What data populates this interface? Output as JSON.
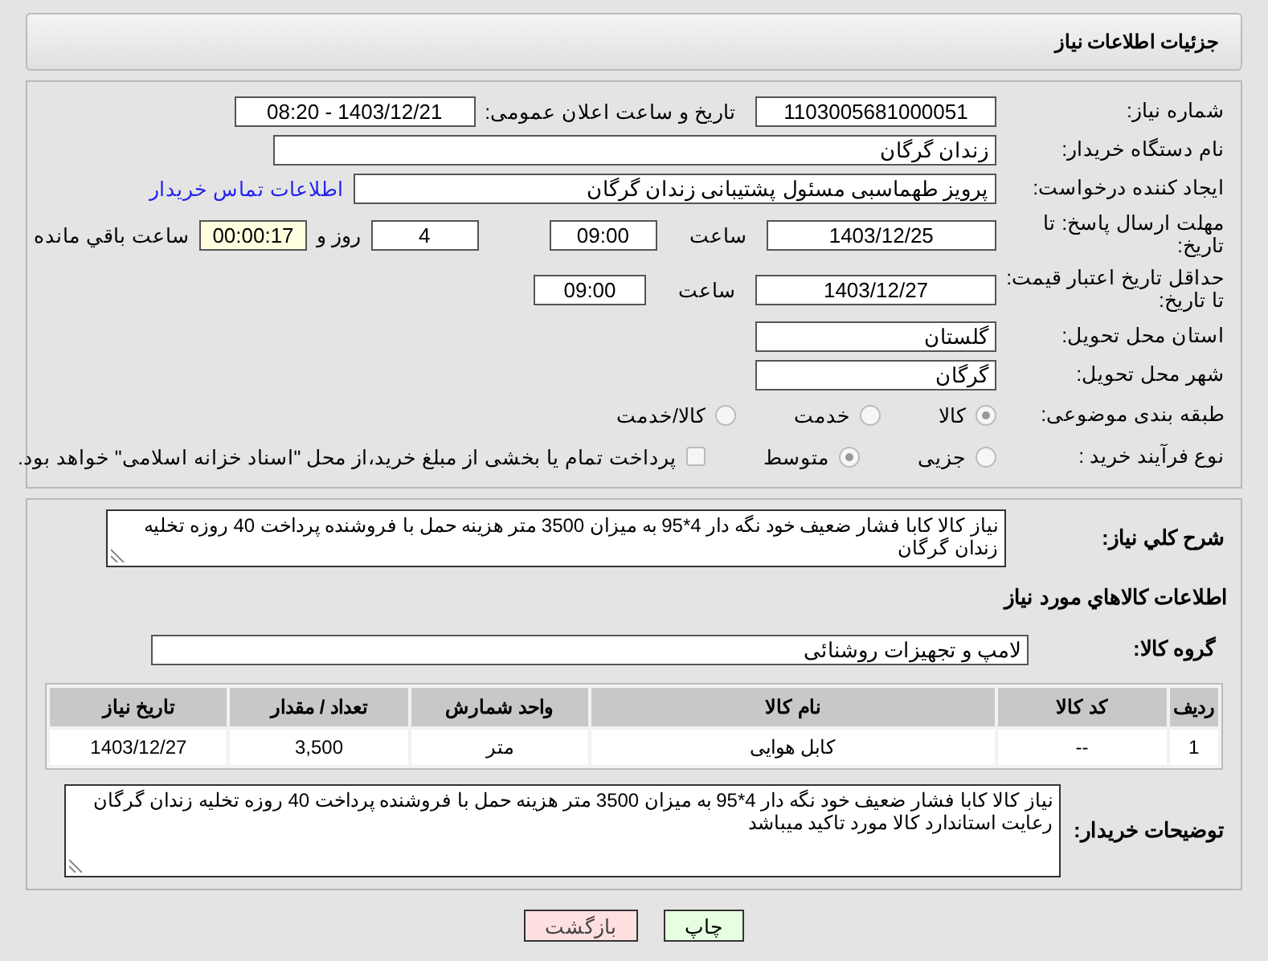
{
  "header": {
    "title": "جزئیات اطلاعات نیاز"
  },
  "form": {
    "need_number": {
      "label": "شماره نیاز:",
      "value": "1103005681000051"
    },
    "announce": {
      "label": "تاریخ و ساعت اعلان عمومی:",
      "value": "1403/12/21 - 08:20"
    },
    "buyer_org": {
      "label": "نام دستگاه خریدار:",
      "value": "زندان گرگان"
    },
    "creator": {
      "label": "ایجاد کننده درخواست:",
      "value": "پرویز طهماسبی مسئول پشتیبانی زندان گرگان",
      "link": "اطلاعات تماس خریدار"
    },
    "deadline": {
      "label": "مهلت ارسال پاسخ: تا تاریخ:",
      "date": "1403/12/25",
      "time_label": "ساعت",
      "time": "09:00",
      "days": "4",
      "days_label": "روز و",
      "remaining": "00:00:17",
      "remaining_label": "ساعت باقي مانده"
    },
    "validity": {
      "label": "حداقل تاریخ اعتبار قیمت: تا تاریخ:",
      "date": "1403/12/27",
      "time_label": "ساعت",
      "time": "09:00"
    },
    "province": {
      "label": "استان محل تحویل:",
      "value": "گلستان"
    },
    "city": {
      "label": "شهر محل تحویل:",
      "value": "گرگان"
    },
    "category": {
      "label": "طبقه بندی موضوعی:",
      "options": [
        {
          "label": "کالا",
          "selected": true
        },
        {
          "label": "خدمت",
          "selected": false
        },
        {
          "label": "کالا/خدمت",
          "selected": false
        }
      ]
    },
    "process": {
      "label": "نوع فرآیند خرید :",
      "options": [
        {
          "label": "جزیی",
          "selected": false
        },
        {
          "label": "متوسط",
          "selected": true
        }
      ],
      "treasury": {
        "label": "پرداخت تمام یا بخشی از مبلغ خرید،از محل \"اسناد خزانه اسلامی\" خواهد بود.",
        "checked": false
      }
    }
  },
  "details": {
    "summary": {
      "label": "شرح کلي نياز:",
      "value": "نیاز کالا کابا فشار ضعیف خود نگه دار  4*95 به میزان 3500 متر هزینه حمل با فروشنده پرداخت 40 روزه تخلیه زندان گرگان"
    },
    "items_title": "اطلاعات کالاهاي مورد نياز",
    "group": {
      "label": "گروه کالا:",
      "value": "لامپ و تجهیزات روشنائی"
    },
    "table": {
      "columns": [
        "ردیف",
        "کد کالا",
        "نام کالا",
        "واحد شمارش",
        "تعداد / مقدار",
        "تاریخ نیاز"
      ],
      "rows": [
        [
          "1",
          "--",
          "کابل هوایی",
          "متر",
          "3,500",
          "1403/12/27"
        ]
      ]
    },
    "notes": {
      "label": "توضیحات خریدار:",
      "value": "نیاز کالا کابا فشار ضعیف خود نگه دار  4*95 به میزان 3500 متر هزینه حمل با فروشنده پرداخت 40 روزه تخلیه زندان گرگان رعایت استاندارد کالا مورد تاکید میباشد"
    }
  },
  "buttons": [
    {
      "label": "چاپ",
      "kind": "print"
    },
    {
      "label": "بازگشت",
      "kind": "back"
    }
  ]
}
